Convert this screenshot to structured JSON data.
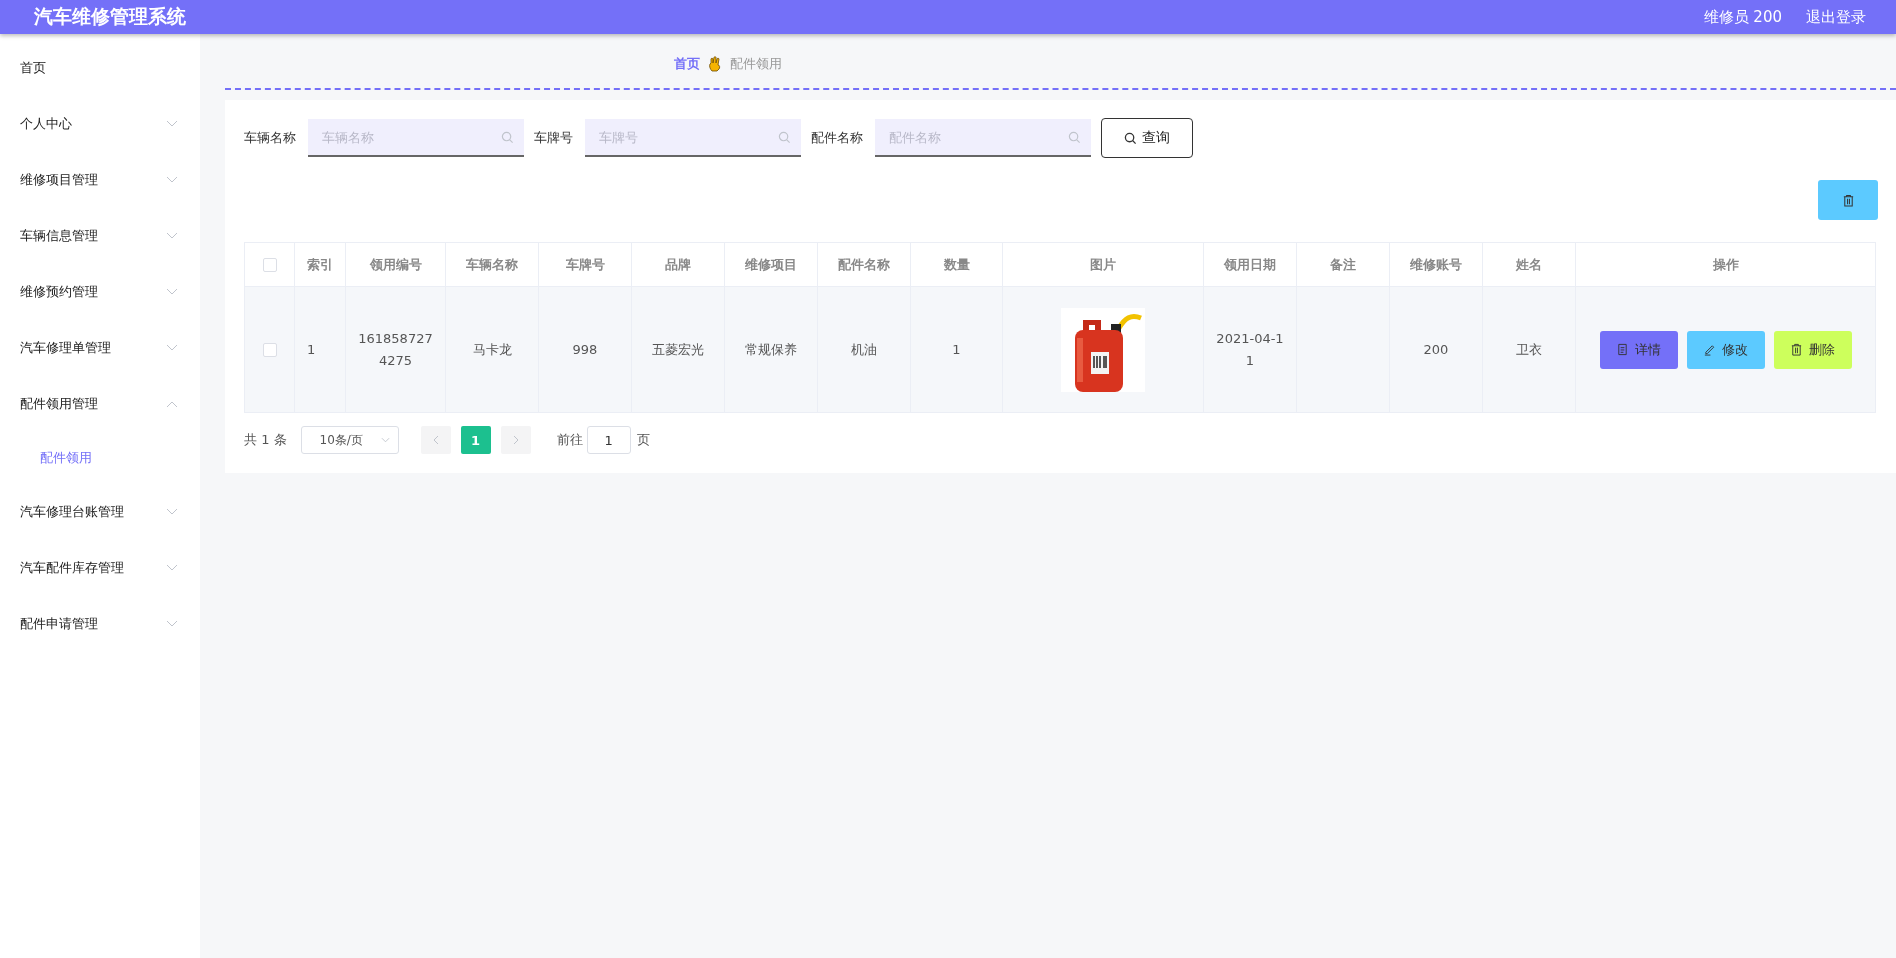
{
  "header": {
    "title": "汽车维修管理系统",
    "user": "维修员 200",
    "logout": "退出登录"
  },
  "sidebar": {
    "items": [
      {
        "label": "首页",
        "kind": "link"
      },
      {
        "label": "个人中心",
        "kind": "menu",
        "expanded": false
      },
      {
        "label": "维修项目管理",
        "kind": "menu",
        "expanded": false
      },
      {
        "label": "车辆信息管理",
        "kind": "menu",
        "expanded": false
      },
      {
        "label": "维修预约管理",
        "kind": "menu",
        "expanded": false
      },
      {
        "label": "汽车修理单管理",
        "kind": "menu",
        "expanded": false
      },
      {
        "label": "配件领用管理",
        "kind": "menu",
        "expanded": true,
        "children": [
          {
            "label": "配件领用",
            "selected": true
          }
        ]
      },
      {
        "label": "汽车修理台账管理",
        "kind": "menu",
        "expanded": false
      },
      {
        "label": "汽车配件库存管理",
        "kind": "menu",
        "expanded": false
      },
      {
        "label": "配件申请管理",
        "kind": "menu",
        "expanded": false
      }
    ]
  },
  "breadcrumb": [
    "首页",
    "配件领用"
  ],
  "search": {
    "fields": [
      {
        "label": "车辆名称",
        "placeholder": "车辆名称"
      },
      {
        "label": "车牌号",
        "placeholder": "车牌号"
      },
      {
        "label": "配件名称",
        "placeholder": "配件名称"
      }
    ],
    "button": "查询"
  },
  "table": {
    "all_checked": false,
    "columns": [
      "索引",
      "领用编号",
      "车辆名称",
      "车牌号",
      "品牌",
      "维修项目",
      "配件名称",
      "数量",
      "图片",
      "领用日期",
      "备注",
      "维修账号",
      "姓名",
      "操作"
    ],
    "rows": [
      {
        "checked": false,
        "cells": [
          "1",
          "1618587274275",
          "马卡龙",
          "998",
          "五菱宏光",
          "常规保养",
          "机油",
          "1",
          {
            "kind": "picture"
          },
          "2021-04-11",
          "",
          "200",
          "卫衣"
        ],
        "actions": [
          {
            "label": "详情",
            "kind": "detail"
          },
          {
            "label": "修改",
            "kind": "edit"
          },
          {
            "label": "删除",
            "kind": "delete"
          }
        ]
      }
    ]
  },
  "pagination": {
    "total": "共 1 条",
    "page_size": "10条/页",
    "pages": [
      {
        "label": "1",
        "selected": true
      }
    ],
    "goto_label": "前往",
    "goto_value": "1",
    "goto_suffix": "页"
  }
}
